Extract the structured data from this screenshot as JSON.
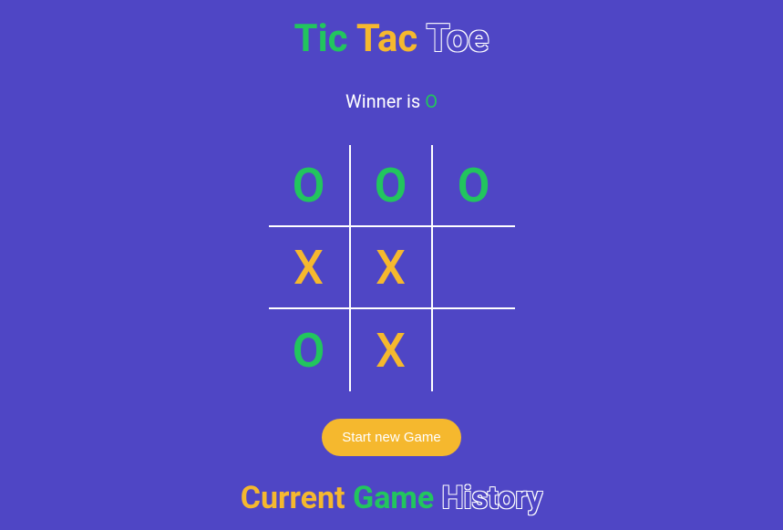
{
  "title": {
    "word1": "Tic",
    "word2": "Tac",
    "word3": "Toe"
  },
  "status": {
    "prefix": "Winner is ",
    "winner": "O"
  },
  "board": {
    "cells": [
      "O",
      "O",
      "O",
      "X",
      "X",
      "",
      "O",
      "X",
      ""
    ]
  },
  "new_game_button": "Start new Game",
  "history_title": {
    "word1": "Current",
    "word2": "Game",
    "word3": "History"
  }
}
